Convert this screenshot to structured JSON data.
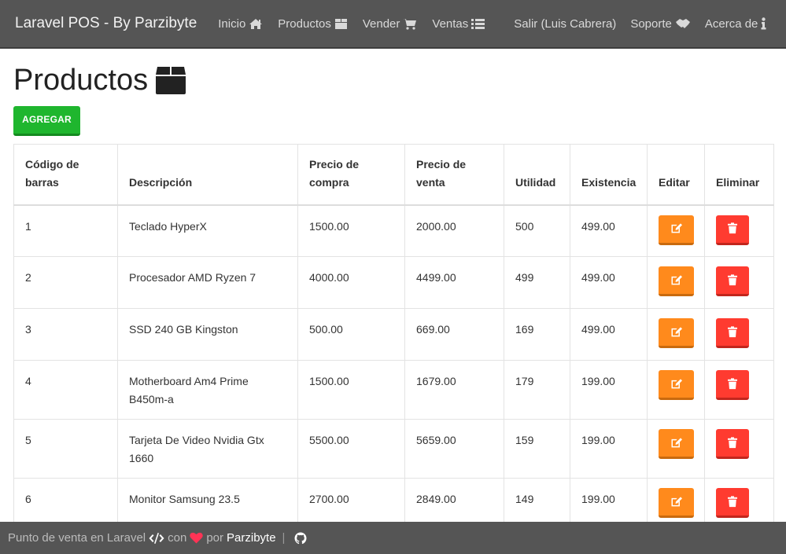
{
  "navbar": {
    "brand": "Laravel POS - By Parzibyte",
    "left_items": [
      {
        "label": "Inicio",
        "icon": "home-icon"
      },
      {
        "label": "Productos",
        "icon": "box-icon"
      },
      {
        "label": "Vender",
        "icon": "cart-icon"
      },
      {
        "label": "Ventas",
        "icon": "list-icon"
      }
    ],
    "right_items": [
      {
        "label": "Salir (Luis Cabrera)"
      },
      {
        "label": "Soporte",
        "icon": "handshake-icon"
      },
      {
        "label": "Acerca de",
        "icon": "info-icon"
      }
    ]
  },
  "page": {
    "title": "Productos",
    "add_button": "AGREGAR"
  },
  "table": {
    "headers": {
      "barcode_1": "Código de",
      "barcode_2": "barras",
      "description": "Descripción",
      "buy_1": "Precio de",
      "buy_2": "compra",
      "sell_1": "Precio de",
      "sell_2": "venta",
      "profit": "Utilidad",
      "stock": "Existencia",
      "edit": "Editar",
      "delete": "Eliminar"
    },
    "rows": [
      {
        "code": "1",
        "description": "Teclado HyperX",
        "buy": "1500.00",
        "sell": "2000.00",
        "profit": "500",
        "stock": "499.00"
      },
      {
        "code": "2",
        "description": "Procesador AMD Ryzen 7",
        "buy": "4000.00",
        "sell": "4499.00",
        "profit": "499",
        "stock": "499.00"
      },
      {
        "code": "3",
        "description": "SSD 240 GB Kingston",
        "buy": "500.00",
        "sell": "669.00",
        "profit": "169",
        "stock": "499.00"
      },
      {
        "code": "4",
        "description": "Motherboard Am4 Prime B450m-a",
        "buy": "1500.00",
        "sell": "1679.00",
        "profit": "179",
        "stock": "199.00"
      },
      {
        "code": "5",
        "description": "Tarjeta De Video Nvidia Gtx 1660",
        "buy": "5500.00",
        "sell": "5659.00",
        "profit": "159",
        "stock": "199.00"
      },
      {
        "code": "6",
        "description": "Monitor Samsung 23.5",
        "buy": "2700.00",
        "sell": "2849.00",
        "profit": "149",
        "stock": "199.00"
      }
    ]
  },
  "footer": {
    "text_1": "Punto de venta en Laravel",
    "text_2": "con",
    "text_3": "por",
    "author": "Parzibyte",
    "separator": "|"
  },
  "colors": {
    "navbar": "#555555",
    "add_button": "#1fb62e",
    "edit_button": "#ff8a1c",
    "delete_button": "#ff3b30",
    "heart": "#ff3355"
  }
}
